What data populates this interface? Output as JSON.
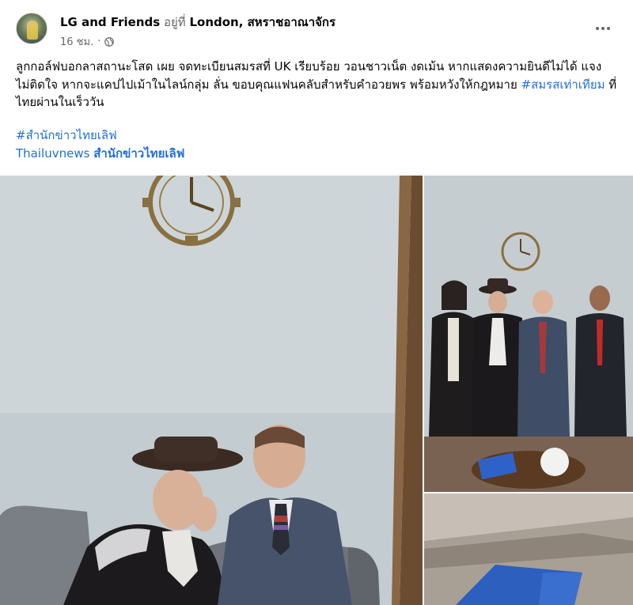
{
  "post": {
    "author": "LG and Friends",
    "at_text": "อยู่ที่",
    "location": "London, สหราชอาณาจักร",
    "time": "16 ชม.",
    "dot": "·",
    "body_text": "ลูกกอล์ฟบอกลาสถานะโสด เผย จดทะเบียนสมรสที่ UK เรียบร้อย วอนชาวเน็ต งดเม้น หากแสดงความยินดีไม่ได้ แจง ไม่ติดใจ หากจะแคปไปเม้าในไลน์กลุ่ม ลั่น ขอบคุณแฟนคลับสำหรับคำอวยพร พร้อมหวังให้กฎหมาย",
    "body_hashtag": "#สมรสเท่าเทียม",
    "body_tail": "ที่ไทยผ่านในเร็ววัน",
    "tag_hashtag": "#สำนักข่าวไทยเลิฟ",
    "tag_link": "Thailuvnews",
    "tag_link_strong": "สำนักข่าวไทยเลิฟ"
  },
  "icons": {
    "globe": "globe-icon",
    "more": "more-options-icon"
  },
  "colors": {
    "link": "#216fdb",
    "secondary_text": "#65676b",
    "text": "#050505"
  }
}
